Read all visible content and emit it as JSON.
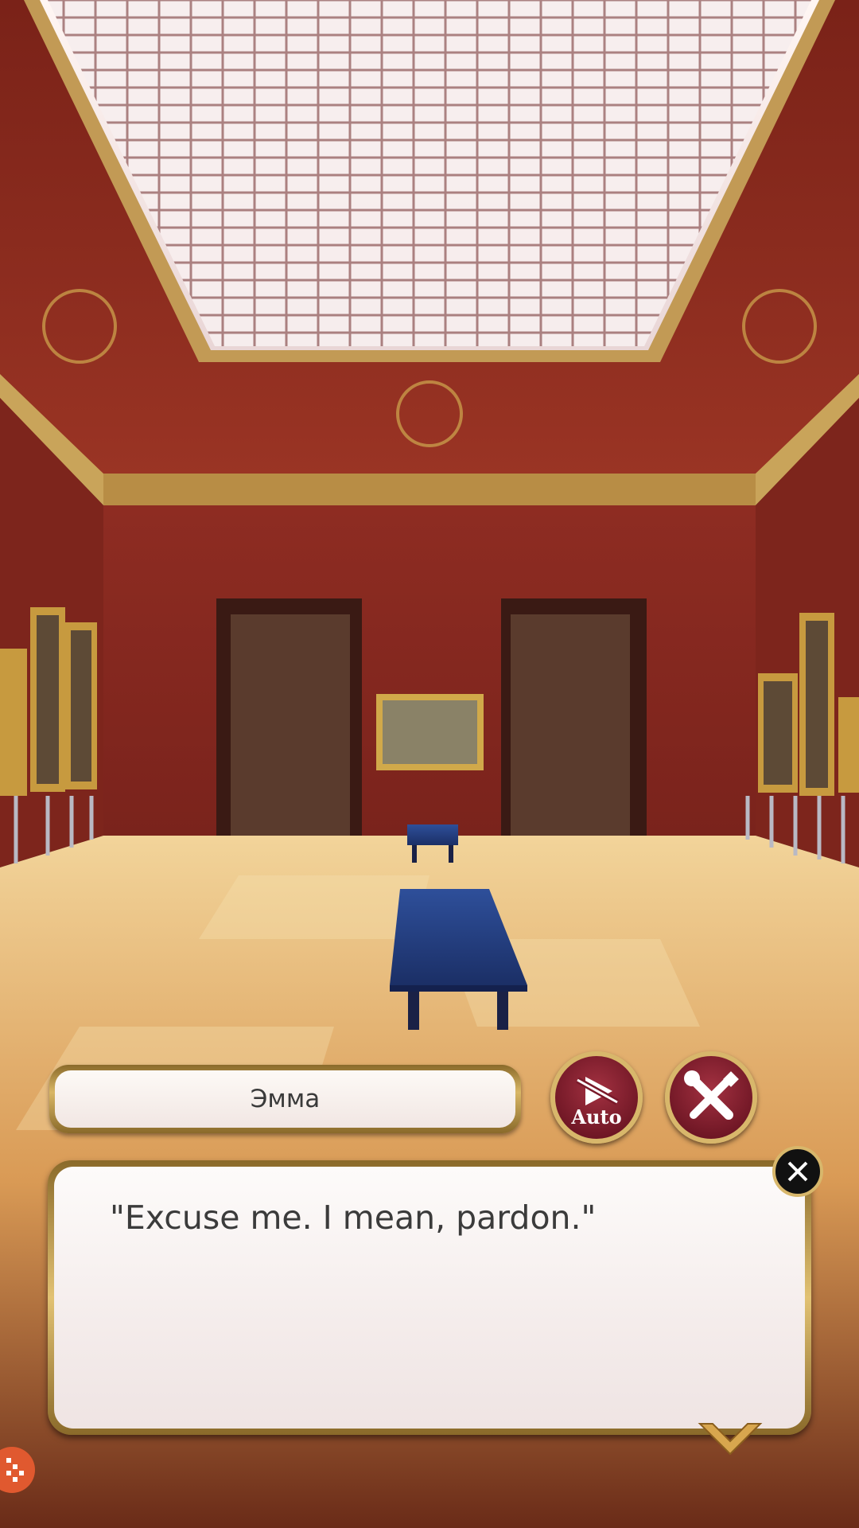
{
  "dialogue": {
    "speaker_name": "Эмма",
    "text": "\"Excuse me. I mean, pardon.\""
  },
  "controls": {
    "auto_label": "Auto",
    "auto_icon": "auto-play-off-icon",
    "settings_icon": "wrench-screwdriver-icon",
    "close_icon": "close-x-icon",
    "next_icon": "chevron-down-icon",
    "corner_icon": "overlay-dots-icon"
  },
  "colors": {
    "button_red": "#8b2233",
    "gold_trim": "#d8b76b",
    "dialog_bg": "#f6eeed",
    "wall_red": "#8c2a22"
  }
}
